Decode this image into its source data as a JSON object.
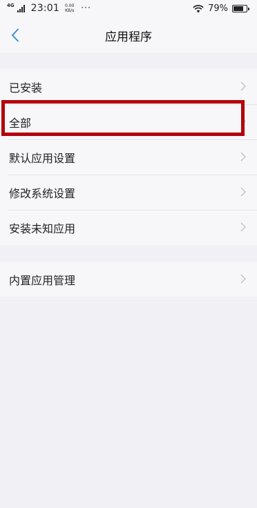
{
  "status_bar": {
    "network_type": "4G",
    "time": "23:01",
    "net_speed_value": "0.00",
    "net_speed_unit": "KB/s",
    "more_indicator": "···",
    "battery_percent": "79%",
    "battery_level": 0.79
  },
  "header": {
    "title": "应用程序",
    "back_icon": "chevron-left-icon"
  },
  "menu": {
    "group1": [
      {
        "label": "已安装"
      },
      {
        "label": "全部"
      },
      {
        "label": "默认应用设置"
      },
      {
        "label": "修改系统设置"
      },
      {
        "label": "安装未知应用"
      }
    ],
    "group2": [
      {
        "label": "内置应用管理"
      }
    ]
  },
  "highlight_color": "#b3000c",
  "accent_color": "#3a8ddc"
}
